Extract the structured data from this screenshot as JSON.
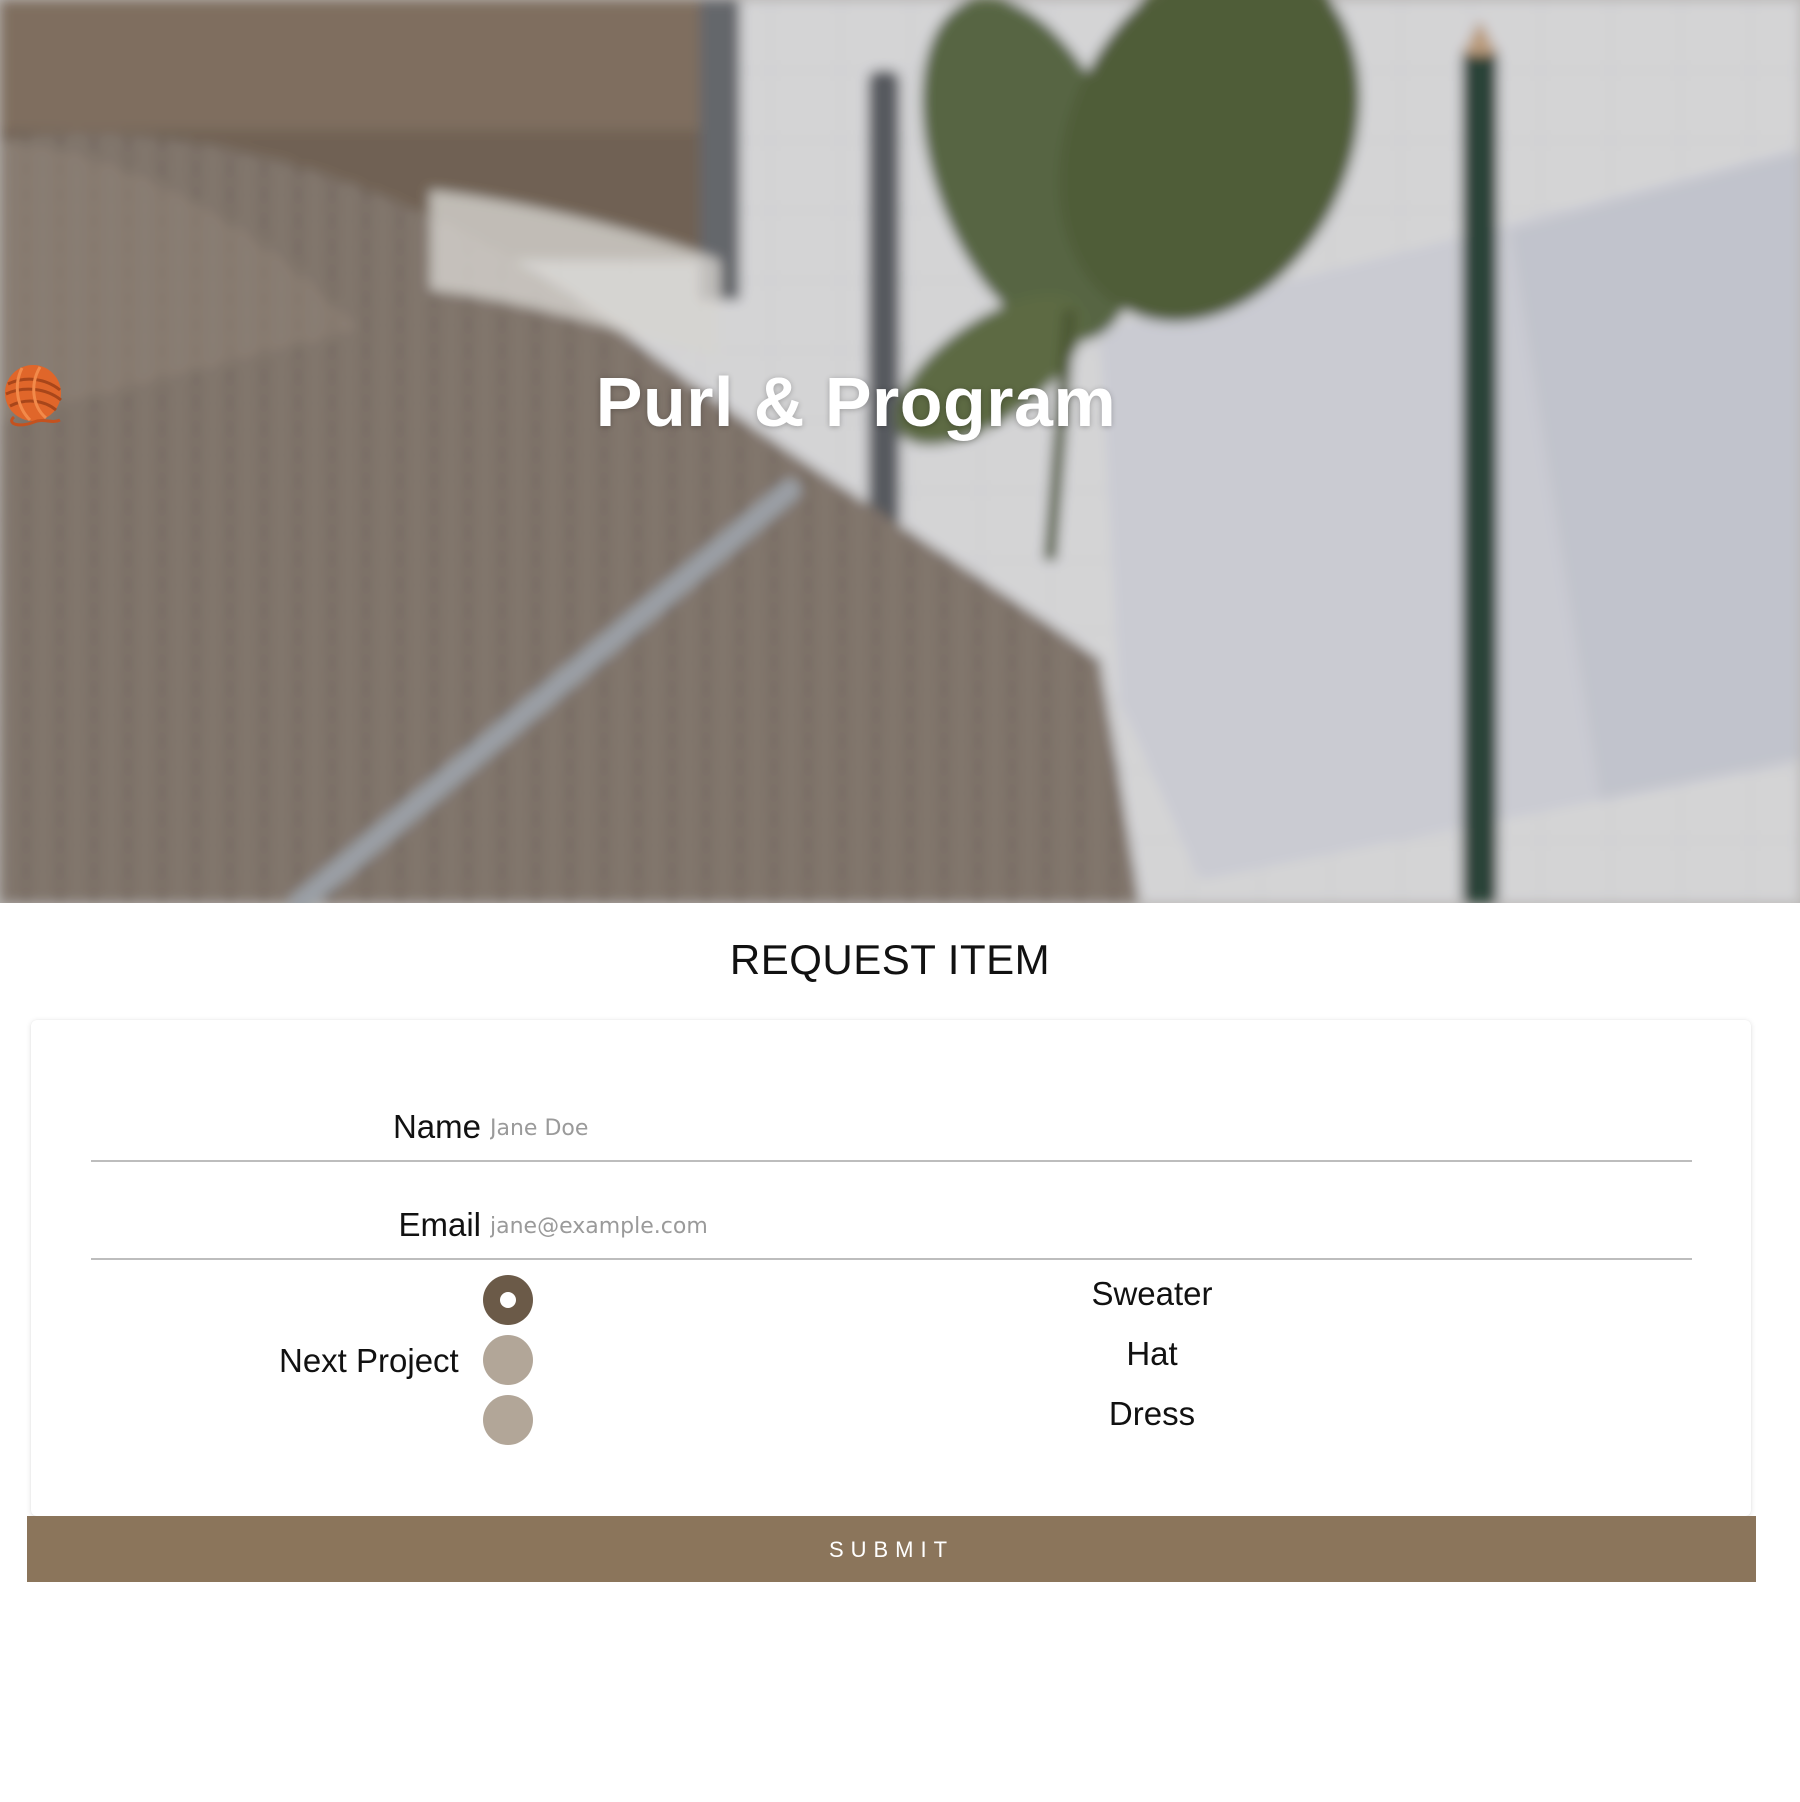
{
  "hero": {
    "title": "Purl & Program",
    "title_icon": "yarn-ball-icon"
  },
  "form": {
    "heading": "REQUEST ITEM",
    "name": {
      "label": "Name",
      "placeholder": "Jane Doe",
      "value": ""
    },
    "email": {
      "label": "Email",
      "placeholder": "jane@example.com",
      "value": ""
    },
    "next_project": {
      "label": "Next Project",
      "options": [
        "Sweater",
        "Hat",
        "Dress"
      ],
      "selected": "Sweater"
    },
    "submit_label": "SUBMIT"
  },
  "colors": {
    "accent": "#8b755b",
    "radio_checked": "#6b5a48",
    "radio_unchecked": "#b2a698"
  }
}
